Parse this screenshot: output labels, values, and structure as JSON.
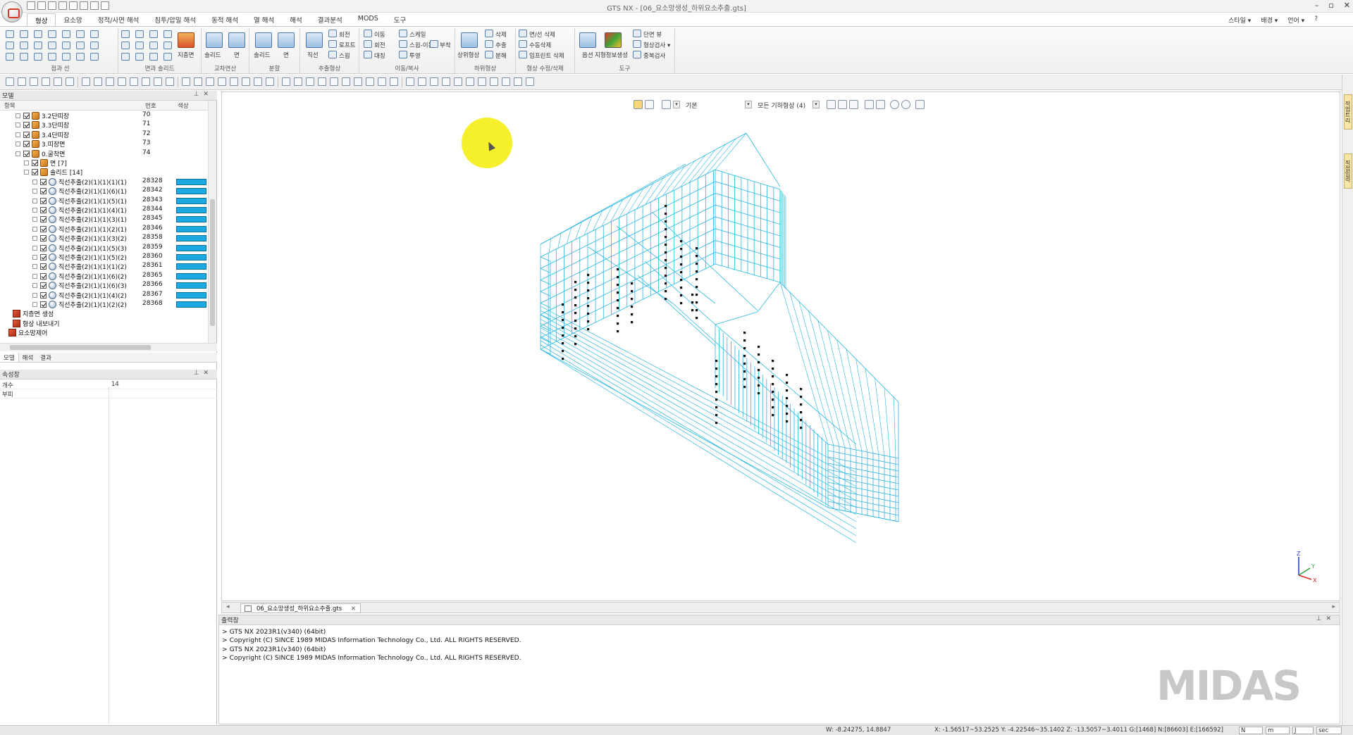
{
  "window": {
    "title": "GTS NX - [06_요소망생성_하위요소추출.gts]",
    "controls": [
      "–",
      "▫",
      "✕"
    ]
  },
  "ribbon": {
    "tabs": [
      "형상",
      "요소망",
      "정적/사면 해석",
      "침투/압밀 해석",
      "동적 해석",
      "열 해석",
      "해석",
      "결과분석",
      "MODS",
      "도구"
    ],
    "active_tab": "형상",
    "right_links": [
      "스타일 ▾",
      "배경 ▾",
      "언어 ▾",
      "?"
    ],
    "groups": [
      {
        "label": "점과 선",
        "items": []
      },
      {
        "label": "면과 솔리드",
        "items": [
          "지층면"
        ]
      },
      {
        "label": "교차연산",
        "items": [
          "솔리드",
          "면"
        ]
      },
      {
        "label": "분할",
        "items": [
          "솔리드",
          "면"
        ]
      },
      {
        "label": "추출형상",
        "items": [
          "직선",
          "회전",
          "로프트",
          "스윕"
        ]
      },
      {
        "label": "이동/복사",
        "items": [
          "이동",
          "스케일",
          "회전",
          "스윕-이동",
          "대칭",
          "투영",
          "부착"
        ]
      },
      {
        "label": "하위형상",
        "items": [
          "상위형상",
          "삭제",
          "추출",
          "분해"
        ]
      },
      {
        "label": "형상 수정/삭제",
        "items": [
          "면/선 삭제",
          "수동삭제",
          "임프린트 삭제"
        ]
      },
      {
        "label": "도구",
        "items": [
          "옵션",
          "지형정보생성",
          "단면 뷰",
          "형상검사 ▾",
          "중복검사"
        ]
      }
    ]
  },
  "model_panel": {
    "title": "모델",
    "columns": {
      "item": "항목",
      "number": "번호",
      "color": "색상"
    },
    "tree": [
      {
        "label": "3.2단띠장",
        "number": "70",
        "level": 0,
        "icon": "cube-icon"
      },
      {
        "label": "3.3단띠장",
        "number": "71",
        "level": 0,
        "icon": "cube-icon"
      },
      {
        "label": "3.4단띠장",
        "number": "72",
        "level": 0,
        "icon": "cube-icon"
      },
      {
        "label": "3.띠장면",
        "number": "73",
        "level": 0,
        "icon": "cube-icon"
      },
      {
        "label": "0.굴착면",
        "number": "74",
        "level": 0,
        "icon": "cube-icon"
      },
      {
        "label": "면 [7]",
        "number": "",
        "level": 1,
        "icon": "cube-icon"
      },
      {
        "label": "솔리드 [14]",
        "number": "",
        "level": 1,
        "icon": "cube-icon"
      },
      {
        "label": "직선추출(2)(1)(1)(1)(1)",
        "number": "28328",
        "level": 2,
        "icon": "sphere-icon",
        "color": "#1aa9e0"
      },
      {
        "label": "직선추출(2)(1)(1)(6)(1)",
        "number": "28342",
        "level": 2,
        "icon": "sphere-icon",
        "color": "#1aa9e0"
      },
      {
        "label": "직선추출(2)(1)(1)(5)(1)",
        "number": "28343",
        "level": 2,
        "icon": "sphere-icon",
        "color": "#1aa9e0"
      },
      {
        "label": "직선추출(2)(1)(1)(4)(1)",
        "number": "28344",
        "level": 2,
        "icon": "sphere-icon",
        "color": "#1aa9e0"
      },
      {
        "label": "직선추출(2)(1)(1)(3)(1)",
        "number": "28345",
        "level": 2,
        "icon": "sphere-icon",
        "color": "#1aa9e0"
      },
      {
        "label": "직선추출(2)(1)(1)(2)(1)",
        "number": "28346",
        "level": 2,
        "icon": "sphere-icon",
        "color": "#1aa9e0"
      },
      {
        "label": "직선추출(2)(1)(1)(3)(2)",
        "number": "28358",
        "level": 2,
        "icon": "sphere-icon",
        "color": "#1aa9e0"
      },
      {
        "label": "직선추출(2)(1)(1)(5)(3)",
        "number": "28359",
        "level": 2,
        "icon": "sphere-icon",
        "color": "#1aa9e0"
      },
      {
        "label": "직선추출(2)(1)(1)(5)(2)",
        "number": "28360",
        "level": 2,
        "icon": "sphere-icon",
        "color": "#1aa9e0"
      },
      {
        "label": "직선추출(2)(1)(1)(1)(2)",
        "number": "28361",
        "level": 2,
        "icon": "sphere-icon",
        "color": "#1aa9e0"
      },
      {
        "label": "직선추출(2)(1)(1)(6)(2)",
        "number": "28365",
        "level": 2,
        "icon": "sphere-icon",
        "color": "#1aa9e0"
      },
      {
        "label": "직선추출(2)(1)(1)(6)(3)",
        "number": "28366",
        "level": 2,
        "icon": "sphere-icon",
        "color": "#1aa9e0"
      },
      {
        "label": "직선추출(2)(1)(1)(4)(2)",
        "number": "28367",
        "level": 2,
        "icon": "sphere-icon",
        "color": "#1aa9e0"
      },
      {
        "label": "직선추출(2)(1)(1)(2)(2)",
        "number": "28368",
        "level": 2,
        "icon": "sphere-icon",
        "color": "#1aa9e0"
      },
      {
        "label": "지층면 생성",
        "number": "",
        "level": -1,
        "icon": "red-icon"
      },
      {
        "label": "형상 내보내기",
        "number": "",
        "level": -1,
        "icon": "red-icon"
      },
      {
        "label": "요소망제어",
        "number": "",
        "level": -2,
        "icon": "red-icon"
      }
    ],
    "bottom_tabs": [
      "모델",
      "해석",
      "결과"
    ]
  },
  "property_panel": {
    "title": "속성창",
    "rows": [
      {
        "key": "개수",
        "value": "14"
      },
      {
        "key": "부피",
        "value": ""
      }
    ]
  },
  "viewport": {
    "view_mode": "기본",
    "display_mode": "모든 기하형상 (4)",
    "mesh_color": "#29b7e3",
    "axes": {
      "z": "Z",
      "y": "Y",
      "x": "X"
    }
  },
  "doc_tab": {
    "label": "06_요소망생성_하위요소추출.gts"
  },
  "output_panel": {
    "title": "출력창",
    "lines": [
      "> GTS NX 2023R1(v340) (64bit)",
      "> Copyright (C) SINCE 1989 MIDAS Information Technology Co., Ltd. ALL RIGHTS RESERVED.",
      "> GTS NX 2023R1(v340) (64bit)",
      "> Copyright (C) SINCE 1989 MIDAS Information Technology Co., Ltd. ALL RIGHTS RESERVED."
    ],
    "logo": "MIDAS"
  },
  "right_tabs": [
    "작업트리",
    "직접입력"
  ],
  "statusbar": {
    "w": "W: -8.24275, 14.8847",
    "coords": "X: -1.56517~53.2525 Y: -4.22546~35.1402 Z: -13.5057~3.4011 G:[1468] N:[86603] E:[166592]",
    "unit_force": "N",
    "unit_length": "m",
    "unit_energy": "J",
    "unit_time": "sec"
  }
}
